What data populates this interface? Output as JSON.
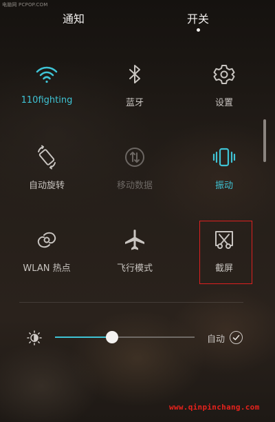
{
  "watermark_top": "电脑网 PCPOP.COM",
  "tabs": {
    "notify": "通知",
    "switch": "开关"
  },
  "tiles": {
    "wifi": {
      "label": "110fighting",
      "icon": "wifi-icon",
      "state": "active"
    },
    "bluetooth": {
      "label": "蓝牙",
      "icon": "bluetooth-icon",
      "state": "off"
    },
    "settings": {
      "label": "设置",
      "icon": "gear-icon",
      "state": "off"
    },
    "rotate": {
      "label": "自动旋转",
      "icon": "rotate-icon",
      "state": "off"
    },
    "mobile_data": {
      "label": "移动数据",
      "icon": "mobile-data-icon",
      "state": "disabled"
    },
    "vibrate": {
      "label": "振动",
      "icon": "vibrate-icon",
      "state": "active"
    },
    "hotspot": {
      "label": "WLAN 热点",
      "icon": "hotspot-icon",
      "state": "off"
    },
    "airplane": {
      "label": "飞行模式",
      "icon": "airplane-icon",
      "state": "off"
    },
    "screenshot": {
      "label": "截屏",
      "icon": "screenshot-icon",
      "state": "off"
    }
  },
  "brightness": {
    "level": 0.41,
    "auto_label": "自动",
    "auto_checked": true
  },
  "colors": {
    "accent": "#3fc4d6",
    "highlight": "#e02020",
    "text": "#c9c5c1"
  },
  "watermark_bottom": "www.qinpinchang.com"
}
